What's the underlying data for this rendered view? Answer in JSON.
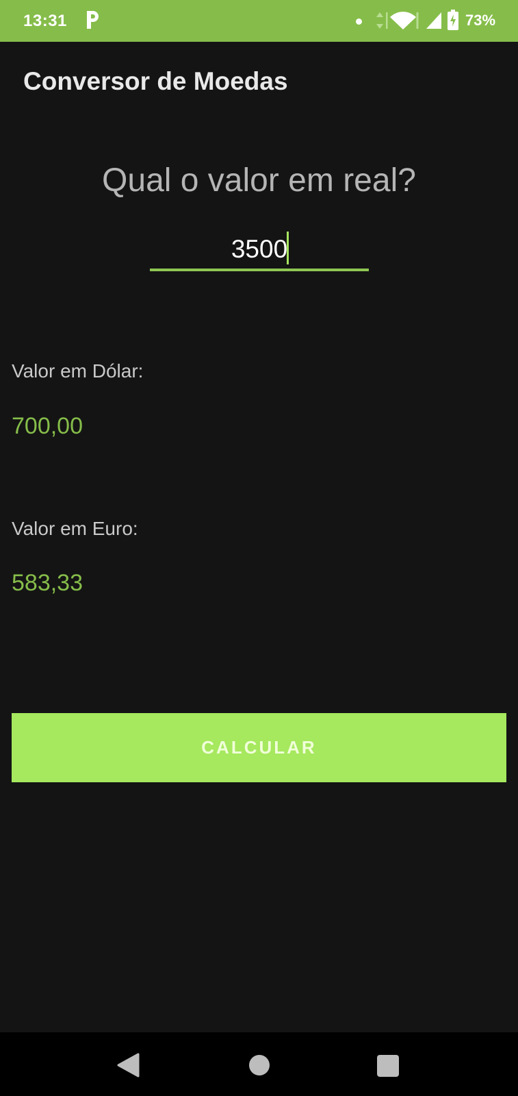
{
  "status_bar": {
    "time": "13:31",
    "battery_percent": "73%",
    "background_color": "#86bd4a",
    "icons": [
      "parking-app-icon",
      "notification-dot-icon",
      "data-arrows-icon",
      "wifi-icon",
      "cell-signal-icon",
      "battery-charging-icon"
    ]
  },
  "app_bar": {
    "title": "Conversor de Moedas"
  },
  "main": {
    "question": "Qual o valor em real?",
    "amount_input": {
      "value": "3500"
    },
    "dollar": {
      "label": "Valor em Dólar:",
      "value": "700,00"
    },
    "euro": {
      "label": "Valor em Euro:",
      "value": "583,33"
    },
    "calculate_button": {
      "label": "CALCULAR",
      "color": "#a6e85e"
    }
  },
  "nav_bar": {
    "icons": [
      "back-icon",
      "home-icon",
      "recent-apps-icon"
    ]
  },
  "colors": {
    "accent": "#86bd4a",
    "background": "#141414",
    "value_text": "#86bd4a"
  }
}
